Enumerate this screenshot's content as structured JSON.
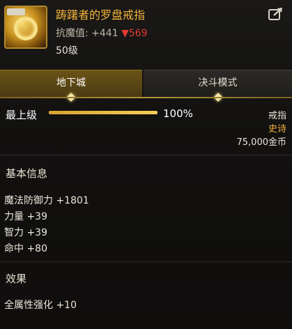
{
  "item": {
    "name": "踌躇者的罗盘戒指",
    "resist_label": "抗魔值:",
    "resist_value": "+441",
    "resist_change": "▼569",
    "level": "50级"
  },
  "tabs": [
    {
      "label": "地下城",
      "active": true
    },
    {
      "label": "决斗模式",
      "active": false
    }
  ],
  "grade": {
    "label": "最上级",
    "percent_text": "100%",
    "fill_fraction": 1.0
  },
  "meta": {
    "type": "戒指",
    "rarity": "史诗",
    "price": "75,000金币"
  },
  "basic": {
    "title": "基本信息",
    "stats": [
      "魔法防御力 +1801",
      "力量 +39",
      "智力 +39",
      "命中 +80"
    ]
  },
  "effects": {
    "title": "效果",
    "lines": [
      "全属性强化 +10"
    ]
  },
  "colors": {
    "item_name": "#f2b23a",
    "rarity": "#f2b23a",
    "decrease": "#e53935"
  },
  "icons": {
    "share": "share-icon",
    "item": "ring-item-icon"
  }
}
